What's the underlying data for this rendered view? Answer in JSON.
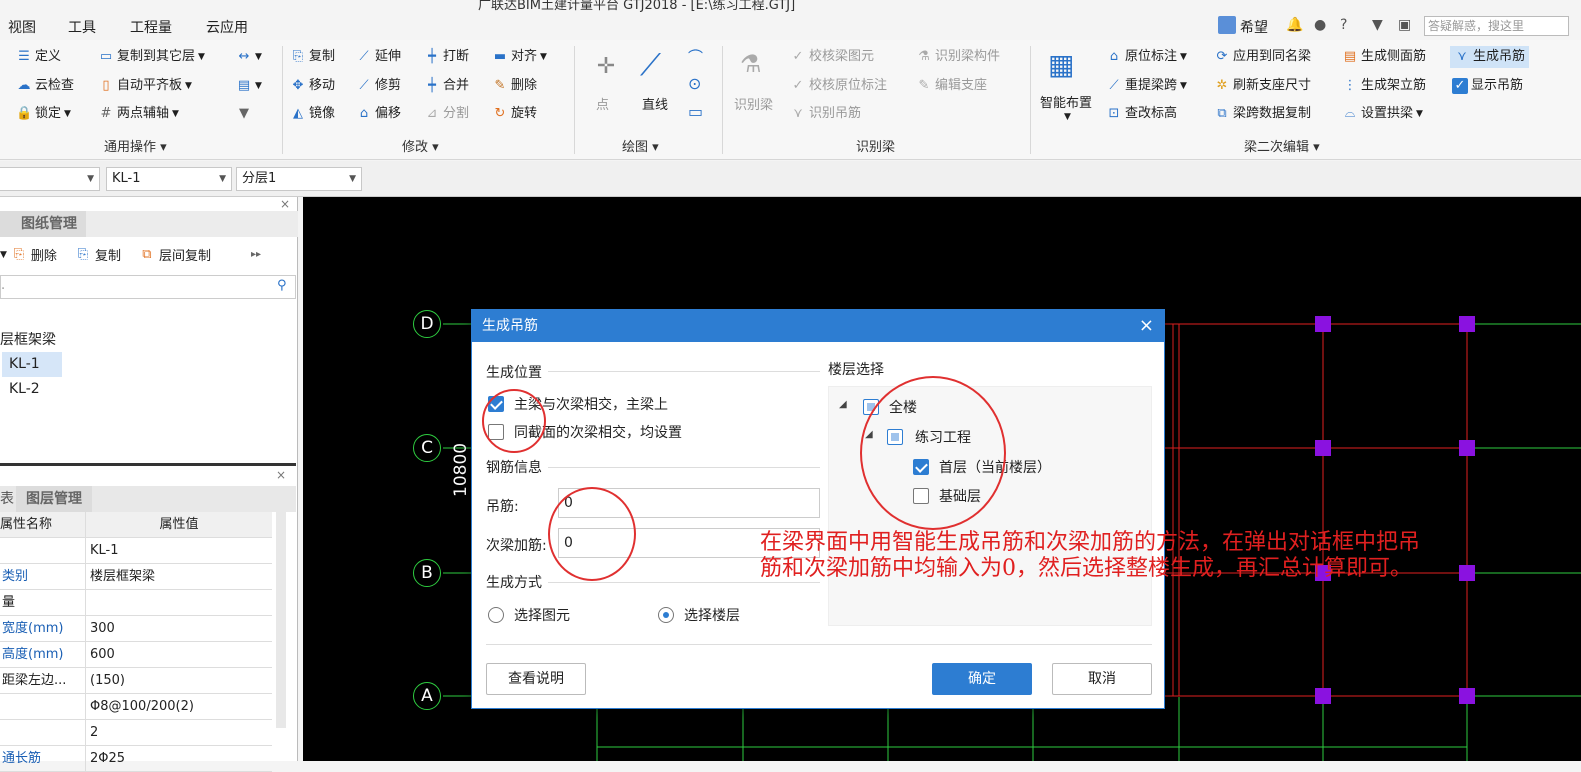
{
  "titlebar": {
    "text": "广联达BIM土建计量平台 GTJ2018 - [E:\\练习工程.GTJ]"
  },
  "menu": [
    "视图",
    "工具",
    "工程量",
    "云应用"
  ],
  "help": {
    "user": "希望",
    "search_placeholder": "答疑解惑，搜这里",
    "question": "?"
  },
  "ribbon": {
    "common": {
      "define": "定义",
      "copy_floor": "复制到其它层",
      "cloud_check": "云检查",
      "auto_level": "自动平齐板",
      "lock": "锁定",
      "two_point": "两点辅轴",
      "group": "通用操作"
    },
    "modify": {
      "copy": "复制",
      "extend": "延伸",
      "break": "打断",
      "align": "对齐",
      "move": "移动",
      "trim": "修剪",
      "merge": "合并",
      "delete": "删除",
      "mirror": "镜像",
      "offset": "偏移",
      "split": "分割",
      "rotate": "旋转",
      "group": "修改"
    },
    "draw": {
      "point": "点",
      "line": "直线",
      "group": "绘图"
    },
    "identify": {
      "identify_beam": "识别梁",
      "check_beam": "校核梁图元",
      "check_original": "校核原位标注",
      "identify_hanger": "识别吊筋",
      "identify_comp": "识别梁构件",
      "edit_support": "编辑支座",
      "group": "识别梁"
    },
    "secondary": {
      "smart": "智能布置",
      "original_mark": "原位标注",
      "re_span": "重提梁跨",
      "check_elev": "查改标高",
      "apply_same": "应用到同名梁",
      "refresh": "刷新支座尺寸",
      "span_copy": "梁跨数据复制",
      "side_rebar": "生成侧面筋",
      "frame_rebar": "生成架立筋",
      "set_arch": "设置拱梁",
      "gen_hanger": "生成吊筋",
      "show_hanger": "显示吊筋",
      "group": "梁二次编辑"
    }
  },
  "toolbar2": {
    "combo2": "KL-1",
    "combo3": "分层1"
  },
  "leftpanel": {
    "tab_top": "图纸管理",
    "actions": {
      "delete": "删除",
      "copy": "复制",
      "floor_copy": "层间复制"
    },
    "tree": {
      "group": "层框架梁",
      "items": [
        "KL-1",
        "KL-2"
      ]
    },
    "tab_bottom_1": "表",
    "tab_bottom_2": "图层管理",
    "prop_headers": {
      "name": "属性名称",
      "value": "属性值"
    },
    "props": [
      {
        "name": "",
        "value": "KL-1"
      },
      {
        "name": "类别",
        "value": "楼层框架梁"
      },
      {
        "name": "量",
        "value": ""
      },
      {
        "name": "宽度(mm)",
        "value": "300"
      },
      {
        "name": "高度(mm)",
        "value": "600"
      },
      {
        "name": "距梁左边...",
        "value": "(150)"
      },
      {
        "name": "",
        "value": "Φ8@100/200(2)"
      },
      {
        "name": "",
        "value": "2"
      },
      {
        "name": "通长筋",
        "value": "2Φ25"
      }
    ]
  },
  "canvas": {
    "axes": [
      "D",
      "C",
      "B",
      "A"
    ],
    "dimension": "10800",
    "note": [
      "在梁界面中用智能生成吊筋和次梁加筋的方法，在弹出对话框中把吊",
      "筋和次梁加筋中均输入为0，然后选择整楼生成，再汇总计算即可。"
    ]
  },
  "dialog": {
    "title": "生成吊筋",
    "close": "×",
    "position_section": "生成位置",
    "opt1": "主梁与次梁相交，主梁上",
    "opt2": "同截面的次梁相交，均设置",
    "rebar_section": "钢筋信息",
    "hanger_label": "吊筋:",
    "hanger_value": "0",
    "secondary_label": "次梁加筋:",
    "secondary_value": "0",
    "method_section": "生成方式",
    "method1": "选择图元",
    "method2": "选择楼层",
    "floor_section": "楼层选择",
    "floor_tree": {
      "all": "全楼",
      "project": "练习工程",
      "first": "首层（当前楼层）",
      "base": "基础层"
    },
    "help_btn": "查看说明",
    "ok_btn": "确定",
    "cancel_btn": "取消"
  },
  "colors": {
    "accent": "#2d7dd2",
    "annotation": "#e03030",
    "beam": "#e02020",
    "column": "#8a12e0",
    "grid": "#2ecc40"
  }
}
